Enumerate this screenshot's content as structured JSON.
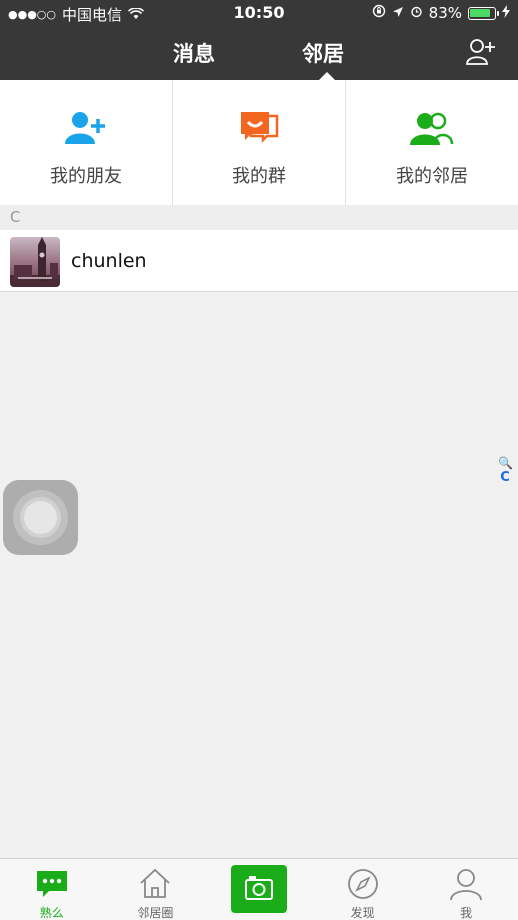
{
  "status": {
    "carrier": "中国电信",
    "time": "10:50",
    "battery": "83%",
    "signal_dots": "●●●○○"
  },
  "header": {
    "tabs": [
      {
        "label": "消息"
      },
      {
        "label": "邻居"
      }
    ],
    "active_tab": "邻居"
  },
  "quick_actions": [
    {
      "label": "我的朋友",
      "icon": "add-friend-icon",
      "color": "#1aa3e8"
    },
    {
      "label": "我的群",
      "icon": "group-chat-icon",
      "color": "#f2661f"
    },
    {
      "label": "我的邻居",
      "icon": "neighbors-icon",
      "color": "#1aad19"
    }
  ],
  "contacts": {
    "section_letter": "C",
    "items": [
      {
        "name": "chunlen",
        "avatar": "london-photo"
      }
    ]
  },
  "index_bar": {
    "search": "🔍",
    "letters": [
      "C"
    ]
  },
  "tabbar": {
    "items": [
      {
        "label": "熟么",
        "icon": "chat-bubble-icon",
        "active": true
      },
      {
        "label": "邻居圈",
        "icon": "home-icon",
        "active": false
      },
      {
        "label": "",
        "icon": "camera-icon",
        "active": false
      },
      {
        "label": "发现",
        "icon": "compass-icon",
        "active": false
      },
      {
        "label": "我",
        "icon": "person-icon",
        "active": false
      }
    ]
  },
  "colors": {
    "header_bg": "#383838",
    "accent_green": "#1aad19",
    "accent_blue": "#1aa3e8",
    "accent_orange": "#f2661f"
  }
}
